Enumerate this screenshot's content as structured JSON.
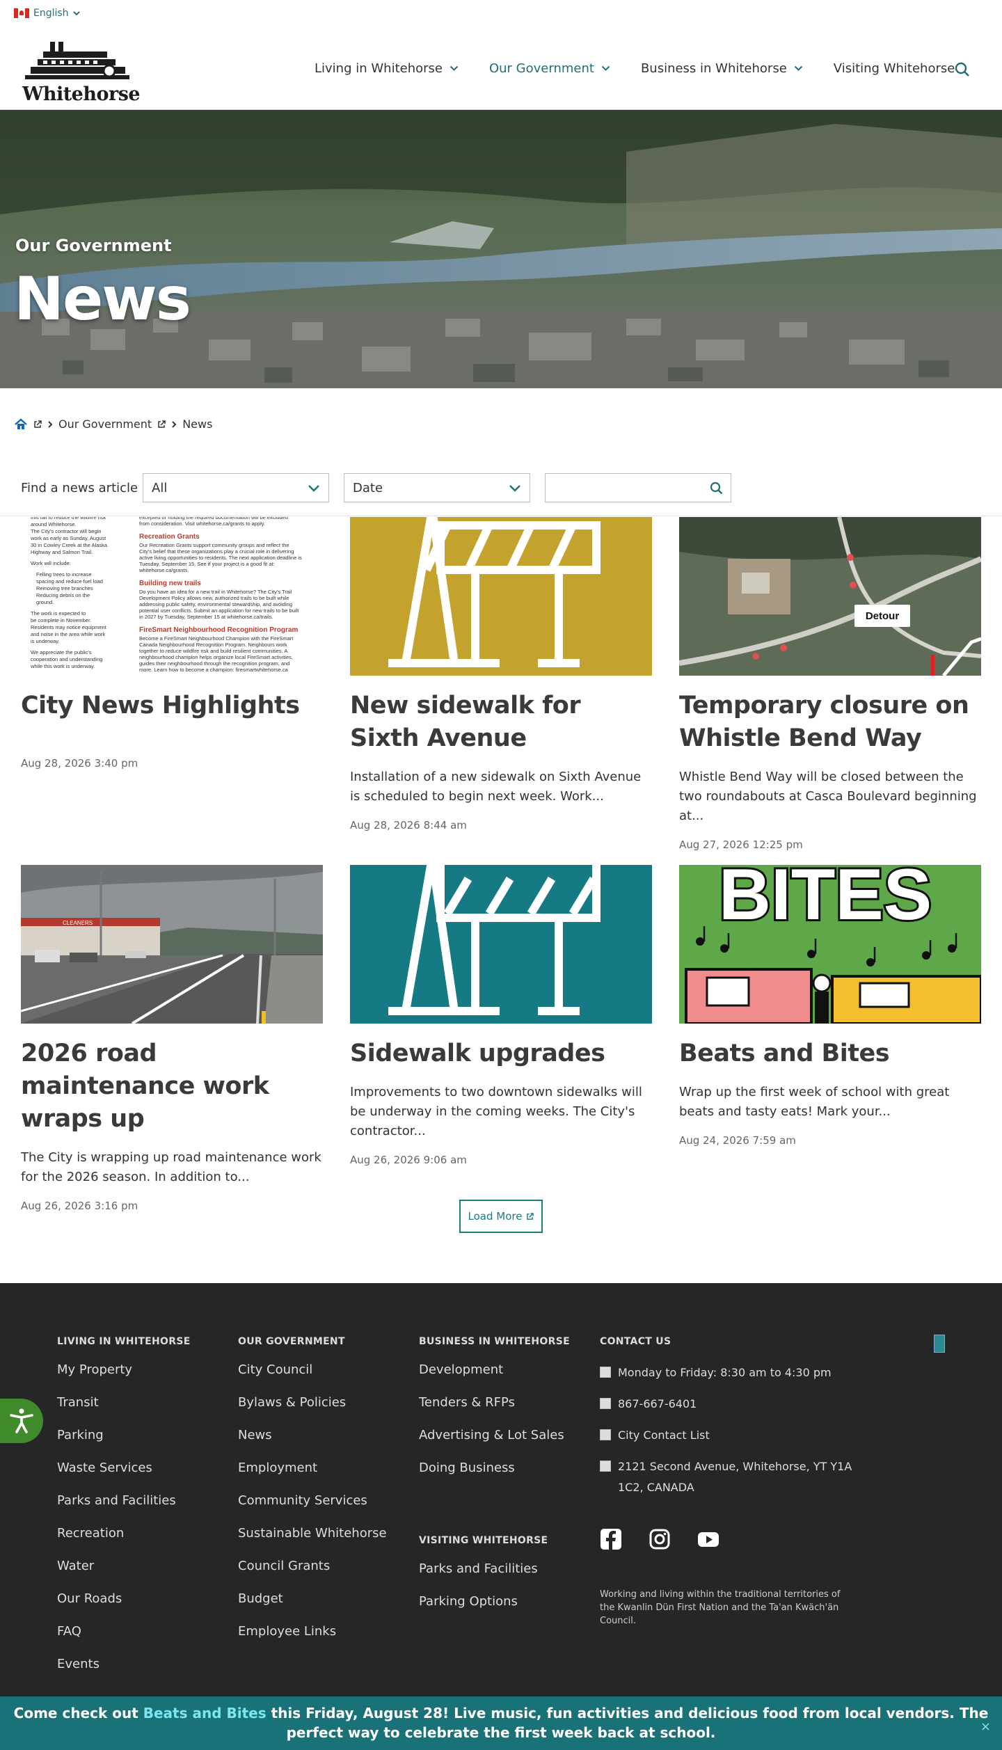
{
  "language": {
    "label": "English"
  },
  "site": {
    "logo_text": "Whitehorse"
  },
  "nav": {
    "items": [
      {
        "label": "Living in Whitehorse",
        "dropdown": true
      },
      {
        "label": "Our Government",
        "dropdown": true,
        "active": true
      },
      {
        "label": "Business in Whitehorse",
        "dropdown": true
      },
      {
        "label": "Visiting Whitehorse",
        "dropdown": false
      }
    ]
  },
  "hero": {
    "kicker": "Our Government",
    "title": "News"
  },
  "breadcrumb": {
    "section": "Our Government",
    "current": "News"
  },
  "filter": {
    "label": "Find a news article",
    "category_value": "All",
    "date_value": "Date",
    "search_value": ""
  },
  "articles": [
    {
      "title": "City News Highlights",
      "summary": "",
      "date": "Aug 28, 2026 3:40 pm"
    },
    {
      "title": "New sidewalk for Sixth Avenue",
      "summary": "Installation of a new sidewalk on Sixth Avenue is scheduled to begin next week. Work...",
      "date": "Aug 28, 2026 8:44 am"
    },
    {
      "title": "Temporary closure on Whistle Bend Way",
      "summary": "Whistle Bend Way will be closed between the two roundabouts at Casca Boulevard beginning at...",
      "date": "Aug 27, 2026 12:25 pm"
    },
    {
      "title": "2026 road maintenance work wraps up",
      "summary": "The City is wrapping up road maintenance work for the 2026 season. In addition to...",
      "date": "Aug 26, 2026 3:16 pm"
    },
    {
      "title": "Sidewalk upgrades",
      "summary": "Improvements to two downtown sidewalks will be underway in the coming weeks. The City's contractor...",
      "date": "Aug 26, 2026 9:06 am"
    },
    {
      "title": "Beats and Bites",
      "summary": "Wrap up the first week of school with great beats and tasty eats! Mark your...",
      "date": "Aug 24, 2026 7:59 am"
    }
  ],
  "newsletter_thumb": {
    "lines": [
      "this fall to reduce the wildfire risk",
      "around Whitehorse.",
      "The City's contractor will begin",
      "work as early as Sunday, August",
      "30 in Cowley Creek at the Alaska",
      "Highway and Salmon Trail.",
      "Work will include:",
      "Felling trees to increase",
      "spacing and reduce fuel load",
      "Removing tree branches",
      "Reducing debris on the",
      "ground.",
      "The work is expected to",
      "be complete in November.",
      "Residents may notice equipment",
      "and noise in the area while work",
      "is underway.",
      "We appreciate the public's",
      "cooperation and understanding",
      "while this work is underway."
    ],
    "headings": [
      "Recreation Grants",
      "Building new trails",
      "FireSmart Neighbourhood Recognition Program"
    ],
    "right_lines_1": [
      "excepted or holding the required documentation will be excluded",
      "from consideration. Visit whitehorse.ca/grants to apply."
    ],
    "right_lines_2": [
      "Our Recreation Grants support community groups and reflect the",
      "City's belief that these organizations play a crucial role in delivering",
      "active living opportunities to residents. The next application deadline is",
      "Tuesday, September 15. See if your project is a good fit at:",
      "whitehorse.ca/grants."
    ],
    "right_lines_3": [
      "Do you have an idea for a new trail in Whitehorse? The City's Trail",
      "Development Policy allows new, authorized trails to be built while",
      "addressing public safety, environmental stewardship, and avoiding",
      "potential user conflicts. Submit an application for new trails to be built",
      "in 2027 by Tuesday, September 15 at whitehorse.ca/trails."
    ],
    "right_lines_4": [
      "Become a FireSmart Neighbourhood Champion with the FireSmart",
      "Canada Neighbourhood Recognition Program. Neighbours work",
      "together to reduce wildfire risk and build resilient communities. A",
      "neighbourhood champion helps organize local FireSmart activities,",
      "guides their neighbourhood through the recognition program, and",
      "more. Learn how to become a champion: firesmartwhitehorse.ca"
    ]
  },
  "map_label": "Detour",
  "bites_text": "BITES",
  "shop_sign": "CLEANERS",
  "load_more": "Load More",
  "footer": {
    "columns": [
      {
        "heading": "LIVING IN WHITEHORSE",
        "links": [
          "My Property",
          "Transit",
          "Parking",
          "Waste Services",
          "Parks and Facilities",
          "Recreation",
          "Water",
          "Our Roads",
          "FAQ",
          "Events"
        ]
      },
      {
        "heading": "OUR GOVERNMENT",
        "links": [
          "City Council",
          "Bylaws & Policies",
          "News",
          "Employment",
          "Community Services",
          "Sustainable Whitehorse",
          "Council Grants",
          "Budget",
          "Employee Links"
        ]
      },
      {
        "heading": "BUSINESS IN WHITEHORSE",
        "links": [
          "Development",
          "Tenders & RFPs",
          "Advertising & Lot Sales",
          "Doing Business"
        ]
      },
      {
        "heading": "VISITING WHITEHORSE",
        "links": [
          "Parks and Facilities",
          "Parking Options"
        ]
      }
    ],
    "contact": {
      "heading": "CONTACT US",
      "hours": "Monday to Friday: 8:30 am to 4:30 pm",
      "phone": "867-667-6401",
      "list": "City Contact List",
      "address": "2121 Second Avenue, Whitehorse, YT Y1A 1C2, CANADA"
    },
    "territory": "Working and living within the traditional territories of the Kwanlin Dün First Nation and the Ta'an Kwäch'än Council."
  },
  "banner": {
    "before": "Come check out ",
    "link": "Beats and Bites",
    "after": " this Friday, August 28! Live music, fun activities and delicious food from local vendors. The perfect way to celebrate the first week back at school.",
    "close": "×"
  },
  "colors": {
    "accent": "#1a7279",
    "brand_teal": "#1f6f78",
    "footer_bg": "#262626",
    "cone_yellow": "#c4a22e",
    "cone_teal": "#167a84",
    "a11y_green": "#3f8a2b"
  }
}
